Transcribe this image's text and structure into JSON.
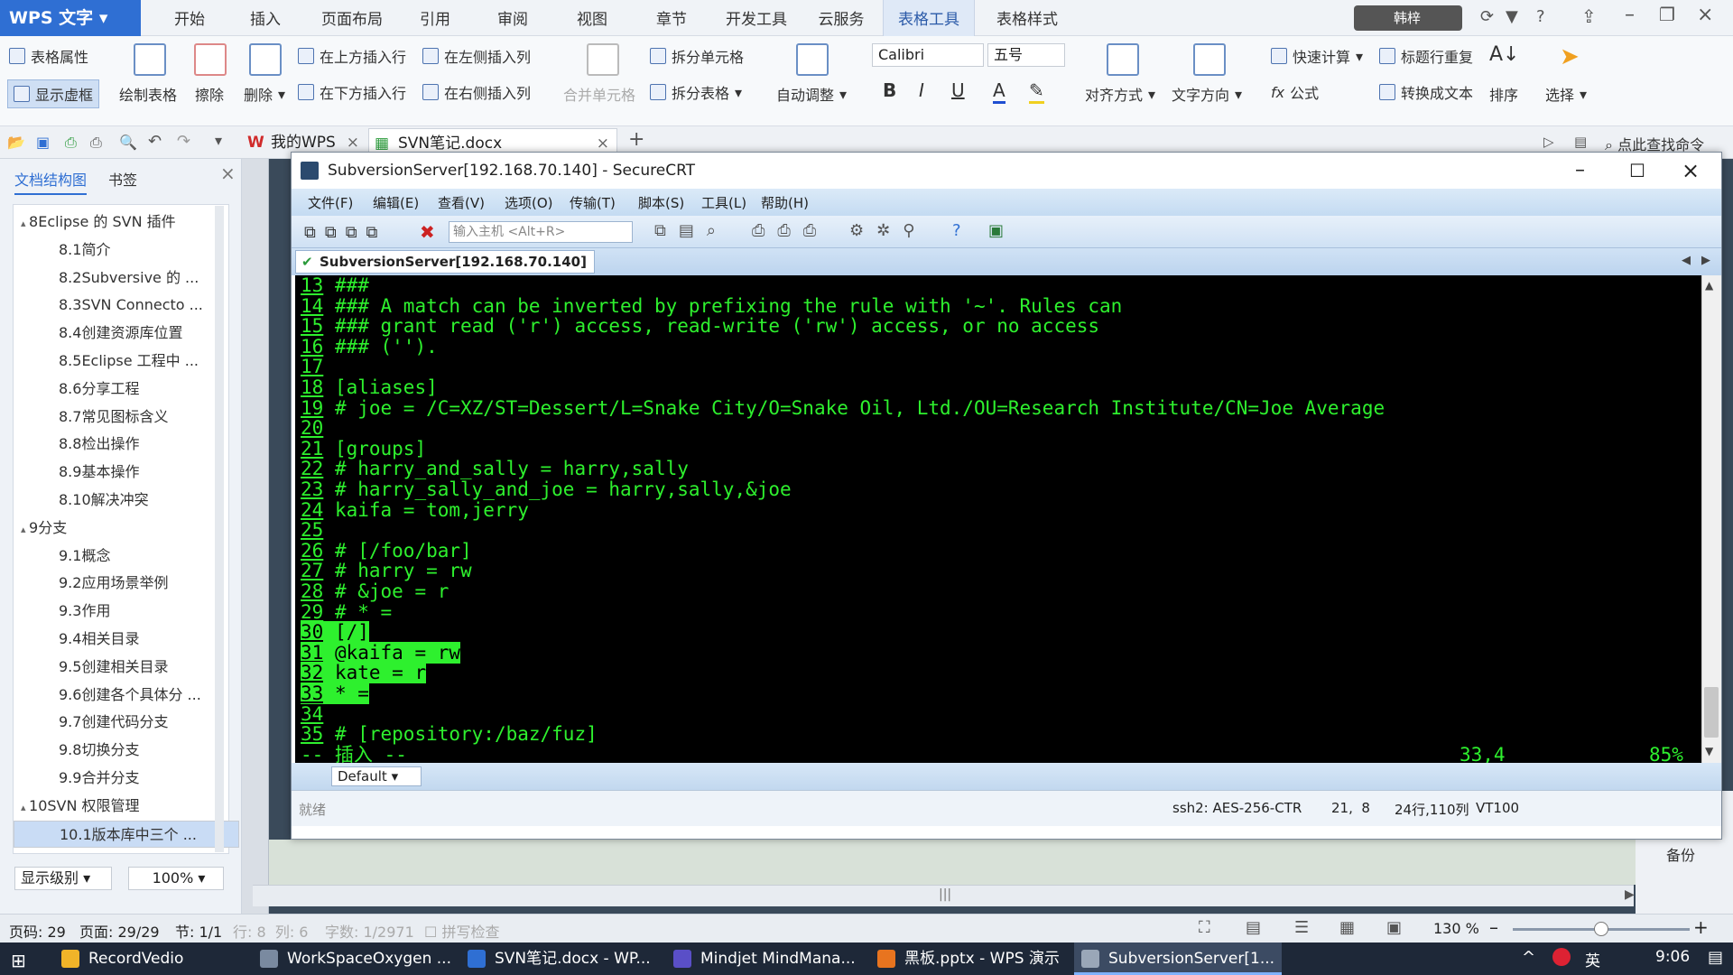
{
  "wps": {
    "app_title": "WPS 文字",
    "menu_tabs": [
      "开始",
      "插入",
      "页面布局",
      "引用",
      "审阅",
      "视图",
      "章节",
      "开发工具",
      "云服务",
      "表格工具",
      "表格样式"
    ],
    "user_label": "韩梓",
    "ribbon": {
      "table_props": "表格属性",
      "show_gridlines": "显示虚框",
      "draw_table": "绘制表格",
      "erase": "擦除",
      "delete": "删除",
      "insert_above": "在上方插入行",
      "insert_below": "在下方插入行",
      "insert_left": "在左侧插入列",
      "insert_right": "在右侧插入列",
      "merge_cells": "合并单元格",
      "split_cells": "拆分单元格",
      "split_table": "拆分表格",
      "auto_adjust": "自动调整",
      "font_name": "Calibri",
      "font_size": "五号",
      "align": "对齐方式",
      "text_direction": "文字方向",
      "quick_calc": "快速计算",
      "header_repeat": "标题行重复",
      "formula": "公式",
      "convert_text": "转换成文本",
      "sort": "排序",
      "select": "选择"
    },
    "doc_tabs": [
      {
        "label": "我的WPS"
      },
      {
        "label": "SVN笔记.docx"
      }
    ],
    "search_label": "点此查找命令",
    "nav": {
      "tab_structure": "文档结构图",
      "tab_bookmark": "书签",
      "items": [
        {
          "label": "8Eclipse 的 SVN 插件",
          "level": 1
        },
        {
          "label": "8.1简介",
          "level": 2
        },
        {
          "label": "8.2Subversive 的 ...",
          "level": 2
        },
        {
          "label": "8.3SVN Connecto ...",
          "level": 2
        },
        {
          "label": "8.4创建资源库位置",
          "level": 2
        },
        {
          "label": "8.5Eclipse 工程中 ...",
          "level": 2
        },
        {
          "label": "8.6分享工程",
          "level": 2
        },
        {
          "label": "8.7常见图标含义",
          "level": 2
        },
        {
          "label": "8.8检出操作",
          "level": 2
        },
        {
          "label": "8.9基本操作",
          "level": 2
        },
        {
          "label": "8.10解决冲突",
          "level": 2
        },
        {
          "label": "9分支",
          "level": 1
        },
        {
          "label": "9.1概念",
          "level": 2
        },
        {
          "label": "9.2应用场景举例",
          "level": 2
        },
        {
          "label": "9.3作用",
          "level": 2
        },
        {
          "label": "9.4相关目录",
          "level": 2
        },
        {
          "label": "9.5创建相关目录",
          "level": 2
        },
        {
          "label": "9.6创建各个具体分 ...",
          "level": 2
        },
        {
          "label": "9.7创建代码分支",
          "level": 2
        },
        {
          "label": "9.8切换分支",
          "level": 2
        },
        {
          "label": "9.9合并分支",
          "level": 2
        },
        {
          "label": "10SVN 权限管理",
          "level": 1
        },
        {
          "label": "10.1版本库中三个 ...",
          "level": 2
        }
      ],
      "level_label": "显示级别",
      "zoom": "100%"
    },
    "status": {
      "page_code": "页码: 29",
      "page": "页面: 29/29",
      "section": "节: 1/1",
      "row_col": "行: 8  列: 6",
      "word_count": "字数: 1/2971",
      "spell": "拼写检查",
      "zoom": "130 %"
    },
    "backup_label": "备份"
  },
  "crt": {
    "title": "SubversionServer[192.168.70.140] - SecureCRT",
    "menu": [
      "文件(F)",
      "编辑(E)",
      "查看(V)",
      "选项(O)",
      "传输(T)",
      "脚本(S)",
      "工具(L)",
      "帮助(H)"
    ],
    "host_placeholder": "输入主机 <Alt+R>",
    "session_tab": "SubversionServer[192.168.70.140]",
    "lines": [
      {
        "n": "13",
        "t": " ###",
        "hl": false
      },
      {
        "n": "14",
        "t": " ### A match can be inverted by prefixing the rule with '~'. Rules can",
        "hl": false
      },
      {
        "n": "15",
        "t": " ### grant read ('r') access, read-write ('rw') access, or no access",
        "hl": false
      },
      {
        "n": "16",
        "t": " ### ('').",
        "hl": false
      },
      {
        "n": "17",
        "t": "",
        "hl": false
      },
      {
        "n": "18",
        "t": " [aliases]",
        "hl": false
      },
      {
        "n": "19",
        "t": " # joe = /C=XZ/ST=Dessert/L=Snake City/O=Snake Oil, Ltd./OU=Research Institute/CN=Joe Average",
        "hl": false
      },
      {
        "n": "20",
        "t": "",
        "hl": false
      },
      {
        "n": "21",
        "t": " [groups]",
        "hl": false
      },
      {
        "n": "22",
        "t": " # harry_and_sally = harry,sally",
        "hl": false
      },
      {
        "n": "23",
        "t": " # harry_sally_and_joe = harry,sally,&joe",
        "hl": false
      },
      {
        "n": "24",
        "t": " kaifa = tom,jerry",
        "hl": false
      },
      {
        "n": "25",
        "t": "",
        "hl": false
      },
      {
        "n": "26",
        "t": " # [/foo/bar]",
        "hl": false
      },
      {
        "n": "27",
        "t": " # harry = rw",
        "hl": false
      },
      {
        "n": "28",
        "t": " # &joe = r",
        "hl": false
      },
      {
        "n": "29",
        "t": " # * =",
        "hl": false
      },
      {
        "n": "30",
        "t": " [/]",
        "hl": true
      },
      {
        "n": "31",
        "t": " @kaifa = rw",
        "hl": true
      },
      {
        "n": "32",
        "t": " kate = r",
        "hl": true
      },
      {
        "n": "33",
        "t": " * =",
        "hl": true
      },
      {
        "n": "34",
        "t": "",
        "hl": false
      },
      {
        "n": "35",
        "t": " # [repository:/baz/fuz]",
        "hl": false
      }
    ],
    "mode_line": "-- 插入 --",
    "cursor_pos": "33,4",
    "scroll_pct": "85%",
    "session_select": "Default",
    "status_ready": "就绪",
    "cipher": "ssh2: AES-256-CTR",
    "pos": "21,  8",
    "size": "24行,110列",
    "term": "VT100"
  },
  "taskbar": {
    "items": [
      {
        "label": "RecordVedio",
        "color": "#f0b429"
      },
      {
        "label": "WorkSpaceOxygen ...",
        "color": "#7a8aa0"
      },
      {
        "label": "SVN笔记.docx - WP...",
        "color": "#2f6fd3"
      },
      {
        "label": "Mindjet MindMana...",
        "color": "#5a4fc7"
      },
      {
        "label": "黑板.pptx - WPS 演示",
        "color": "#e8741f"
      },
      {
        "label": "SubversionServer[1...",
        "color": "#9aa7b8"
      }
    ],
    "ime": "英",
    "time": "9:06"
  }
}
